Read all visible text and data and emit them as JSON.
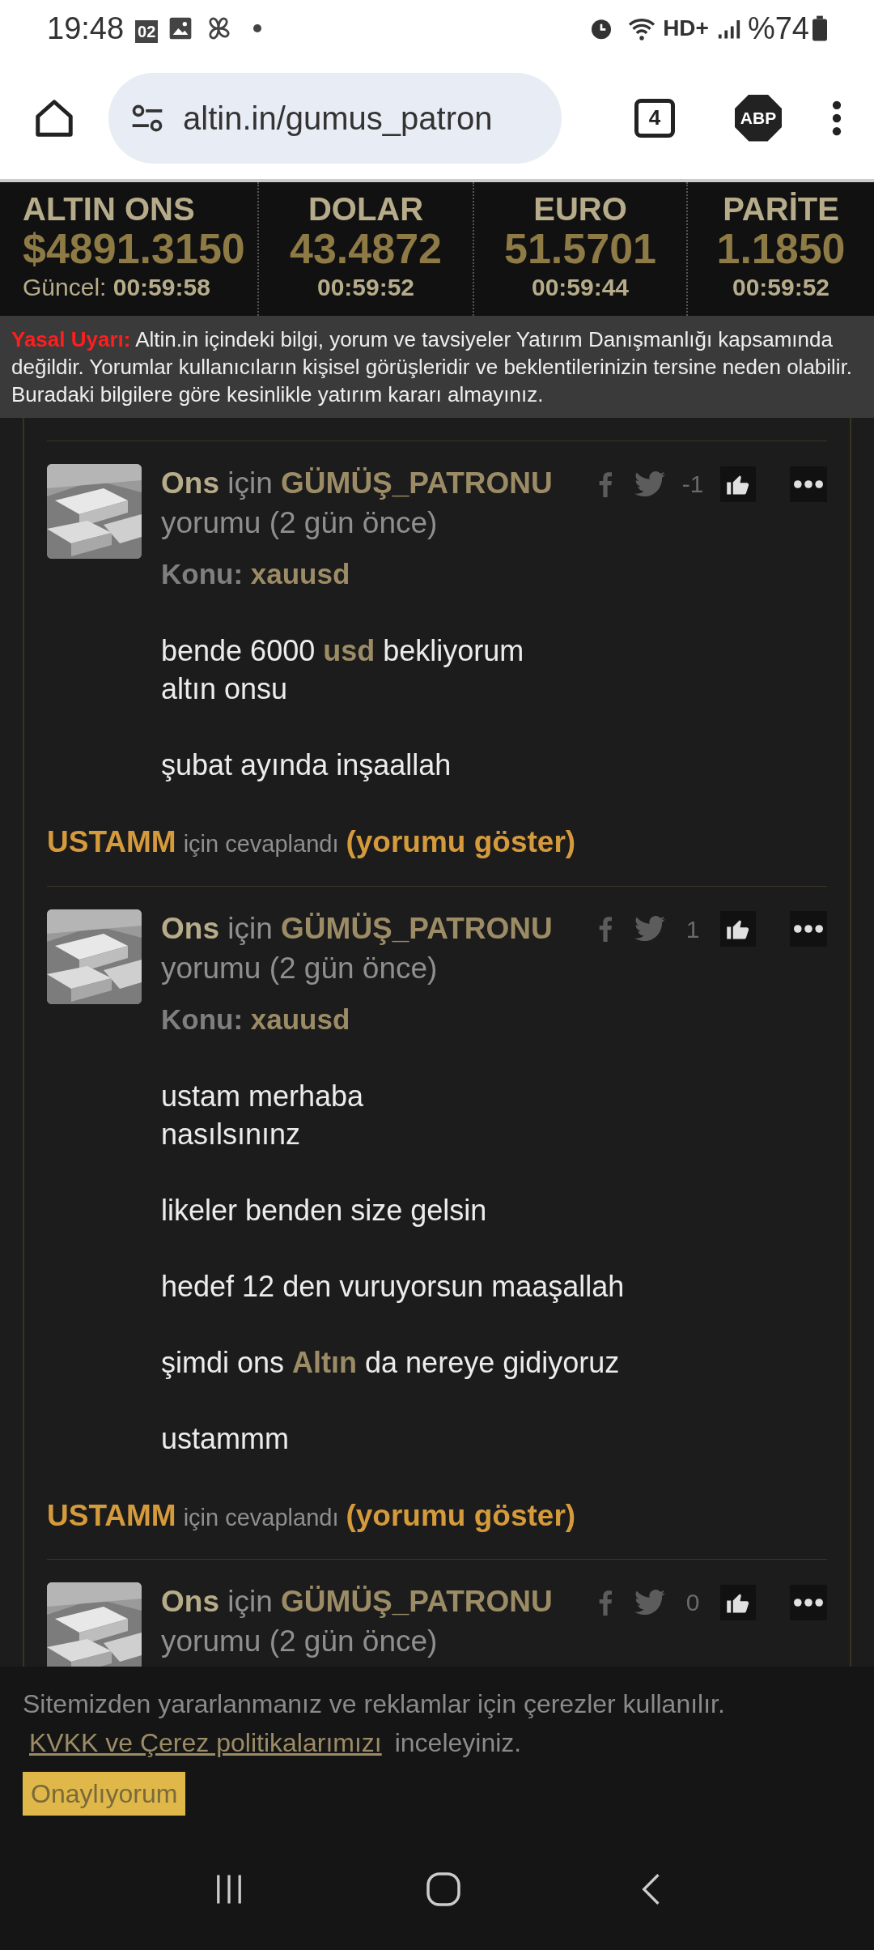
{
  "status_bar": {
    "time": "19:48",
    "calendar_badge": "02",
    "battery": "%74",
    "network": "HD+"
  },
  "browser": {
    "url": "altin.in/gumus_patron",
    "tab_count": "4",
    "adblock": "ABP"
  },
  "ticker": [
    {
      "label": "ALTIN ONS",
      "value": "$4891.3150",
      "prefix": "Güncel:",
      "time": "00:59:58"
    },
    {
      "label": "DOLAR",
      "value": "43.4872",
      "time": "00:59:52"
    },
    {
      "label": "EURO",
      "value": "51.5701",
      "time": "00:59:44"
    },
    {
      "label": "PARİTE",
      "value": "1.1850",
      "time": "00:59:52"
    }
  ],
  "warning": {
    "title": "Yasal Uyarı:",
    "text": "Altin.in içindeki bilgi, yorum ve tavsiyeler Yatırım Danışmanlığı kapsamında değildir. Yorumlar kullanıcıların kişisel görüşleridir ve beklentilerinizin tersine neden olabilir. Buradaki bilgilere göre kesinlikle yatırım kararı almayınız."
  },
  "comments": [
    {
      "topic": "Ons",
      "for": "için",
      "user": "GÜMÜŞ_PATRONU",
      "meta": "yorumu (2 gün önce)",
      "score": "-1",
      "subject_label": "Konu:",
      "subject": "xauusd",
      "body": [
        [
          "bende 6000 **usd** bekliyorum",
          "altın onsu"
        ],
        [
          "şubat ayında inşaallah"
        ]
      ],
      "reply": {
        "user": "USTAMM",
        "text": "için cevaplandı",
        "link": "(yorumu göster)"
      }
    },
    {
      "topic": "Ons",
      "for": "için",
      "user": "GÜMÜŞ_PATRONU",
      "meta": "yorumu (2 gün önce)",
      "score": "1",
      "subject_label": "Konu:",
      "subject": "xauusd",
      "body": [
        [
          "ustam merhaba",
          "nasılsınınz"
        ],
        [
          "likeler benden size gelsin"
        ],
        [
          "hedef 12 den vuruyorsun maaşallah"
        ],
        [
          "şimdi ons **Altın** da nereye gidiyoruz"
        ],
        [
          "ustammm"
        ]
      ],
      "reply": {
        "user": "USTAMM",
        "text": "için cevaplandı",
        "link": "(yorumu göster)"
      }
    },
    {
      "topic": "Ons",
      "for": "için",
      "user": "GÜMÜŞ_PATRONU",
      "meta": "yorumu (2 gün önce)",
      "score": "0"
    }
  ],
  "cookie": {
    "text": "Sitemizden yararlanmanız ve reklamlar için çerezler kullanılır.",
    "link": "KVKK ve Çerez politikalarımızı",
    "after": "inceleyiniz.",
    "button": "Onaylıyorum"
  }
}
